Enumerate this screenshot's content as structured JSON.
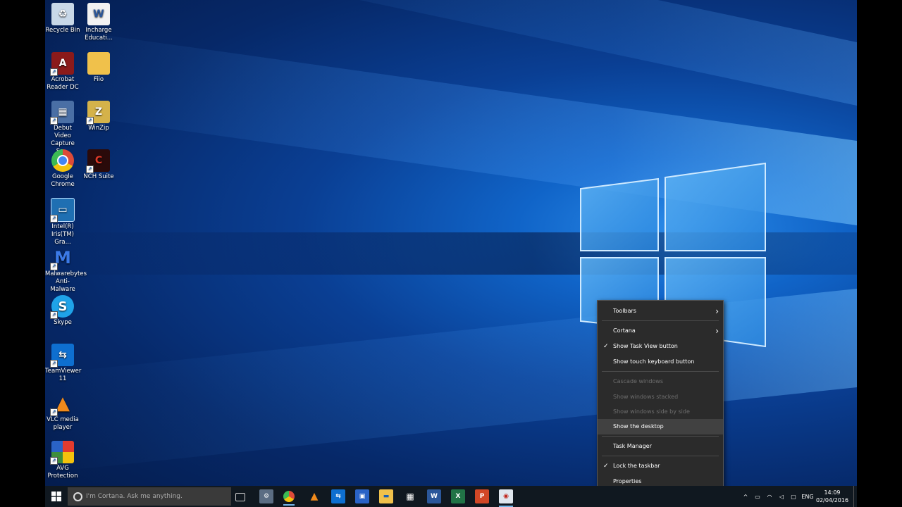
{
  "desktop_icons": [
    {
      "label": "Recycle Bin",
      "icon": "recycle-bin-icon",
      "color": "#c8d8e8"
    },
    {
      "label": "Incharge Educati...",
      "icon": "word-document-icon",
      "color": "#2b579a"
    },
    {
      "label": "Acrobat Reader DC",
      "icon": "acrobat-icon",
      "color": "#8b1a1a"
    },
    {
      "label": "Fiio",
      "icon": "folder-icon",
      "color": "#f0c14b"
    },
    {
      "label": "Debut Video Capture So...",
      "icon": "debut-icon",
      "color": "#4a6fa5"
    },
    {
      "label": "WinZip",
      "icon": "winzip-icon",
      "color": "#d4b24a"
    },
    {
      "label": "Google Chrome",
      "icon": "chrome-icon",
      "color": "#dd4b39"
    },
    {
      "label": "NCH Suite",
      "icon": "nch-icon",
      "color": "#c0281e"
    },
    {
      "label": "Intel(R) Iris(TM) Gra...",
      "icon": "intel-icon",
      "color": "#1f6fb2"
    },
    {
      "label": "Malwarebytes Anti-Malware",
      "icon": "malwarebytes-icon",
      "color": "#2a63c7"
    },
    {
      "label": "Skype",
      "icon": "skype-icon",
      "color": "#1fa3e8"
    },
    {
      "label": "TeamViewer 11",
      "icon": "teamviewer-icon",
      "color": "#0e6fd0"
    },
    {
      "label": "VLC media player",
      "icon": "vlc-icon",
      "color": "#f08a1c"
    },
    {
      "label": "AVG Protection",
      "icon": "avg-icon",
      "color": "#3f8e3c"
    }
  ],
  "context_menu": {
    "items": [
      {
        "label": "Toolbars",
        "arrow": "›"
      },
      {
        "label": "Cortana",
        "arrow": "›"
      },
      {
        "label": "Show Task View button",
        "check": "✓"
      },
      {
        "label": "Show touch keyboard button"
      },
      {
        "label": "Cascade windows"
      },
      {
        "label": "Show windows stacked"
      },
      {
        "label": "Show windows side by side"
      },
      {
        "label": "Show the desktop"
      },
      {
        "label": "Task Manager"
      },
      {
        "label": "Lock the taskbar",
        "check": "✓"
      },
      {
        "label": "Properties"
      }
    ]
  },
  "taskbar": {
    "search_placeholder": "I'm Cortana. Ask me anything.",
    "pinned": [
      {
        "icon": "task-view-icon",
        "glyph": "▭"
      },
      {
        "icon": "connection-icon",
        "glyph": "⚙"
      },
      {
        "icon": "chrome-taskbar-icon",
        "glyph": "●"
      },
      {
        "icon": "vlc-taskbar-icon",
        "glyph": "▲"
      },
      {
        "icon": "teamviewer-taskbar-icon",
        "glyph": "⇆"
      },
      {
        "icon": "network-app-icon",
        "glyph": "▣"
      },
      {
        "icon": "file-explorer-icon",
        "glyph": "▬"
      },
      {
        "icon": "store-icon",
        "glyph": "▦"
      },
      {
        "icon": "word-taskbar-icon",
        "glyph": "W"
      },
      {
        "icon": "excel-taskbar-icon",
        "glyph": "X"
      },
      {
        "icon": "powerpoint-taskbar-icon",
        "glyph": "P"
      },
      {
        "icon": "recorder-app-icon",
        "glyph": "◉"
      }
    ],
    "language": "ENG",
    "time": "14:09",
    "date": "02/04/2016"
  }
}
